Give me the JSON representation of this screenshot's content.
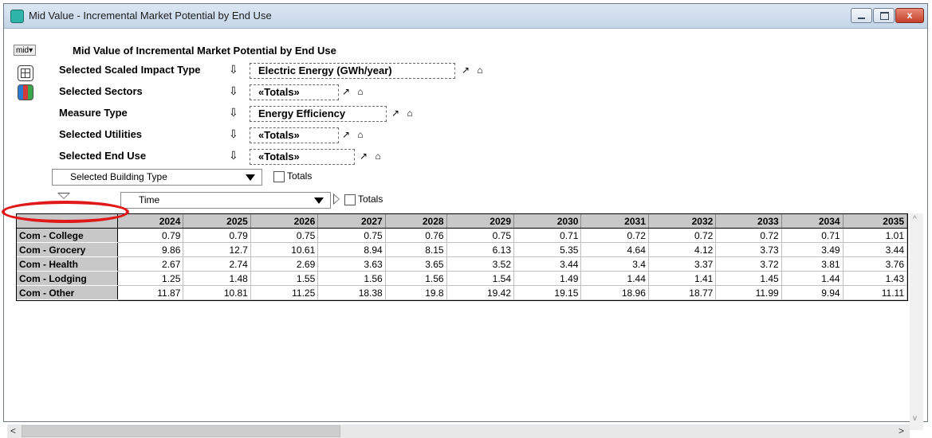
{
  "window": {
    "title": "Mid Value - Incremental Market Potential by End Use",
    "controls": {
      "minimize": "minimize",
      "maximize": "maximize",
      "close": "x"
    }
  },
  "toolbar": {
    "mid_label": "mid▾"
  },
  "header": {
    "title": "Mid Value of Incremental Market Potential by End Use"
  },
  "indexes": [
    {
      "label": "Selected Scaled Impact Type",
      "value": "Electric Energy (GWh/year)"
    },
    {
      "label": "Selected Sectors",
      "value": "«Totals»"
    },
    {
      "label": "Measure Type",
      "value": "Energy Efficiency"
    },
    {
      "label": "Selected Utilities",
      "value": "«Totals»"
    },
    {
      "label": "Selected End Use",
      "value": "«Totals»"
    }
  ],
  "icons": {
    "down_arrow": "⇩",
    "small": "↗ ⌂"
  },
  "row_dim": {
    "label": "Selected Building Type",
    "totals_label": "Totals",
    "totals_checked": false
  },
  "col_dim": {
    "label": "Time",
    "totals_label": "Totals",
    "totals_checked": false
  },
  "table": {
    "columns": [
      "2024",
      "2025",
      "2026",
      "2027",
      "2028",
      "2029",
      "2030",
      "2031",
      "2032",
      "2033",
      "2034",
      "2035"
    ],
    "rows": [
      {
        "label": "Com - College",
        "values": [
          "0.79",
          "0.79",
          "0.75",
          "0.75",
          "0.76",
          "0.75",
          "0.71",
          "0.72",
          "0.72",
          "0.72",
          "0.71",
          "1.01"
        ]
      },
      {
        "label": "Com - Grocery",
        "values": [
          "9.86",
          "12.7",
          "10.61",
          "8.94",
          "8.15",
          "6.13",
          "5.35",
          "4.64",
          "4.12",
          "3.73",
          "3.49",
          "3.44"
        ]
      },
      {
        "label": "Com - Health",
        "values": [
          "2.67",
          "2.74",
          "2.69",
          "3.63",
          "3.65",
          "3.52",
          "3.44",
          "3.4",
          "3.37",
          "3.72",
          "3.81",
          "3.76"
        ]
      },
      {
        "label": "Com - Lodging",
        "values": [
          "1.25",
          "1.48",
          "1.55",
          "1.56",
          "1.56",
          "1.54",
          "1.49",
          "1.44",
          "1.41",
          "1.45",
          "1.44",
          "1.43"
        ]
      },
      {
        "label": "Com - Other",
        "values": [
          "11.87",
          "10.81",
          "11.25",
          "18.38",
          "19.8",
          "19.42",
          "19.15",
          "18.96",
          "18.77",
          "11.99",
          "9.94",
          "11.11"
        ]
      }
    ]
  },
  "scroll": {
    "left": "<",
    "right": ">",
    "up": "^",
    "down": "v"
  },
  "colors": {
    "annotation": "#e01818",
    "titlebar": "#c4d5e8",
    "header_cells": "#c8c8c8"
  }
}
